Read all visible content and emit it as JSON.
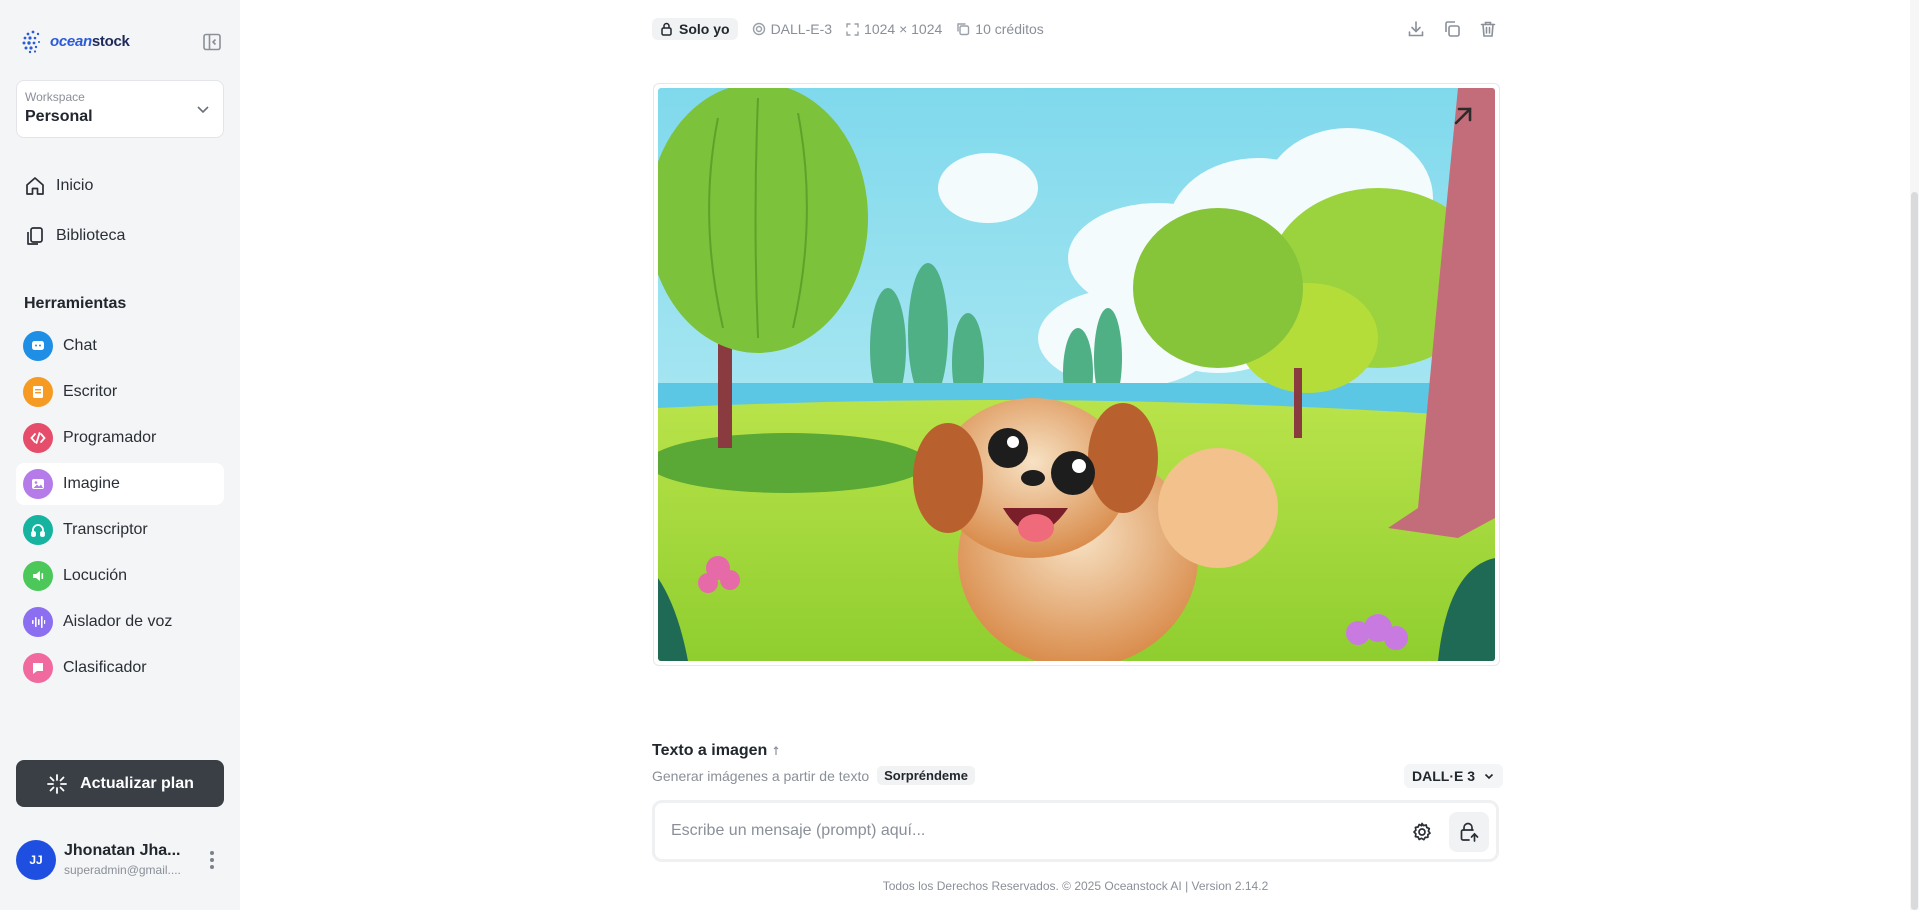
{
  "brand": {
    "name_part1": "ocean",
    "name_part2": "stock"
  },
  "workspace": {
    "label": "Workspace",
    "value": "Personal"
  },
  "nav": [
    {
      "label": "Inicio",
      "icon": "home-icon"
    },
    {
      "label": "Biblioteca",
      "icon": "library-icon"
    }
  ],
  "tools_title": "Herramientas",
  "tools": [
    {
      "label": "Chat",
      "icon": "chat-icon",
      "color": "#1f8fe5"
    },
    {
      "label": "Escritor",
      "icon": "writer-icon",
      "color": "#f59a23"
    },
    {
      "label": "Programador",
      "icon": "code-icon",
      "color": "#e54d6b"
    },
    {
      "label": "Imagine",
      "icon": "image-icon",
      "color": "#b57be8"
    },
    {
      "label": "Transcriptor",
      "icon": "headphones-icon",
      "color": "#16b3a0"
    },
    {
      "label": "Locución",
      "icon": "speaker-icon",
      "color": "#4cc85a"
    },
    {
      "label": "Aislador de voz",
      "icon": "waveform-icon",
      "color": "#8b6ff0"
    },
    {
      "label": "Clasificador",
      "icon": "tag-icon",
      "color": "#f06aa0"
    }
  ],
  "active_tool": "Imagine",
  "upgrade_label": "Actualizar plan",
  "user": {
    "initials": "JJ",
    "name": "Jhonatan Jha...",
    "email": "superadmin@gmail...."
  },
  "meta": {
    "visibility": "Solo yo",
    "model": "DALL-E-3",
    "size": "1024 × 1024",
    "credits": "10 créditos"
  },
  "text_to_image": {
    "title": "Texto a imagen",
    "subtitle": "Generar imágenes a partir de texto",
    "surprise_label": "Sorpréndeme",
    "model_select": "DALL·E 3",
    "prompt_placeholder": "Escribe un mensaje (prompt) aquí...",
    "prompt_value": ""
  },
  "footer": "Todos los Derechos Reservados. © 2025 Oceanstock AI | Version 2.14.2",
  "colors": {
    "sidebar_bg": "#f4f5f6",
    "upgrade_bg": "#3a3f46",
    "avatar_bg": "#1e4fe0",
    "accent": "#2c5bd8"
  }
}
